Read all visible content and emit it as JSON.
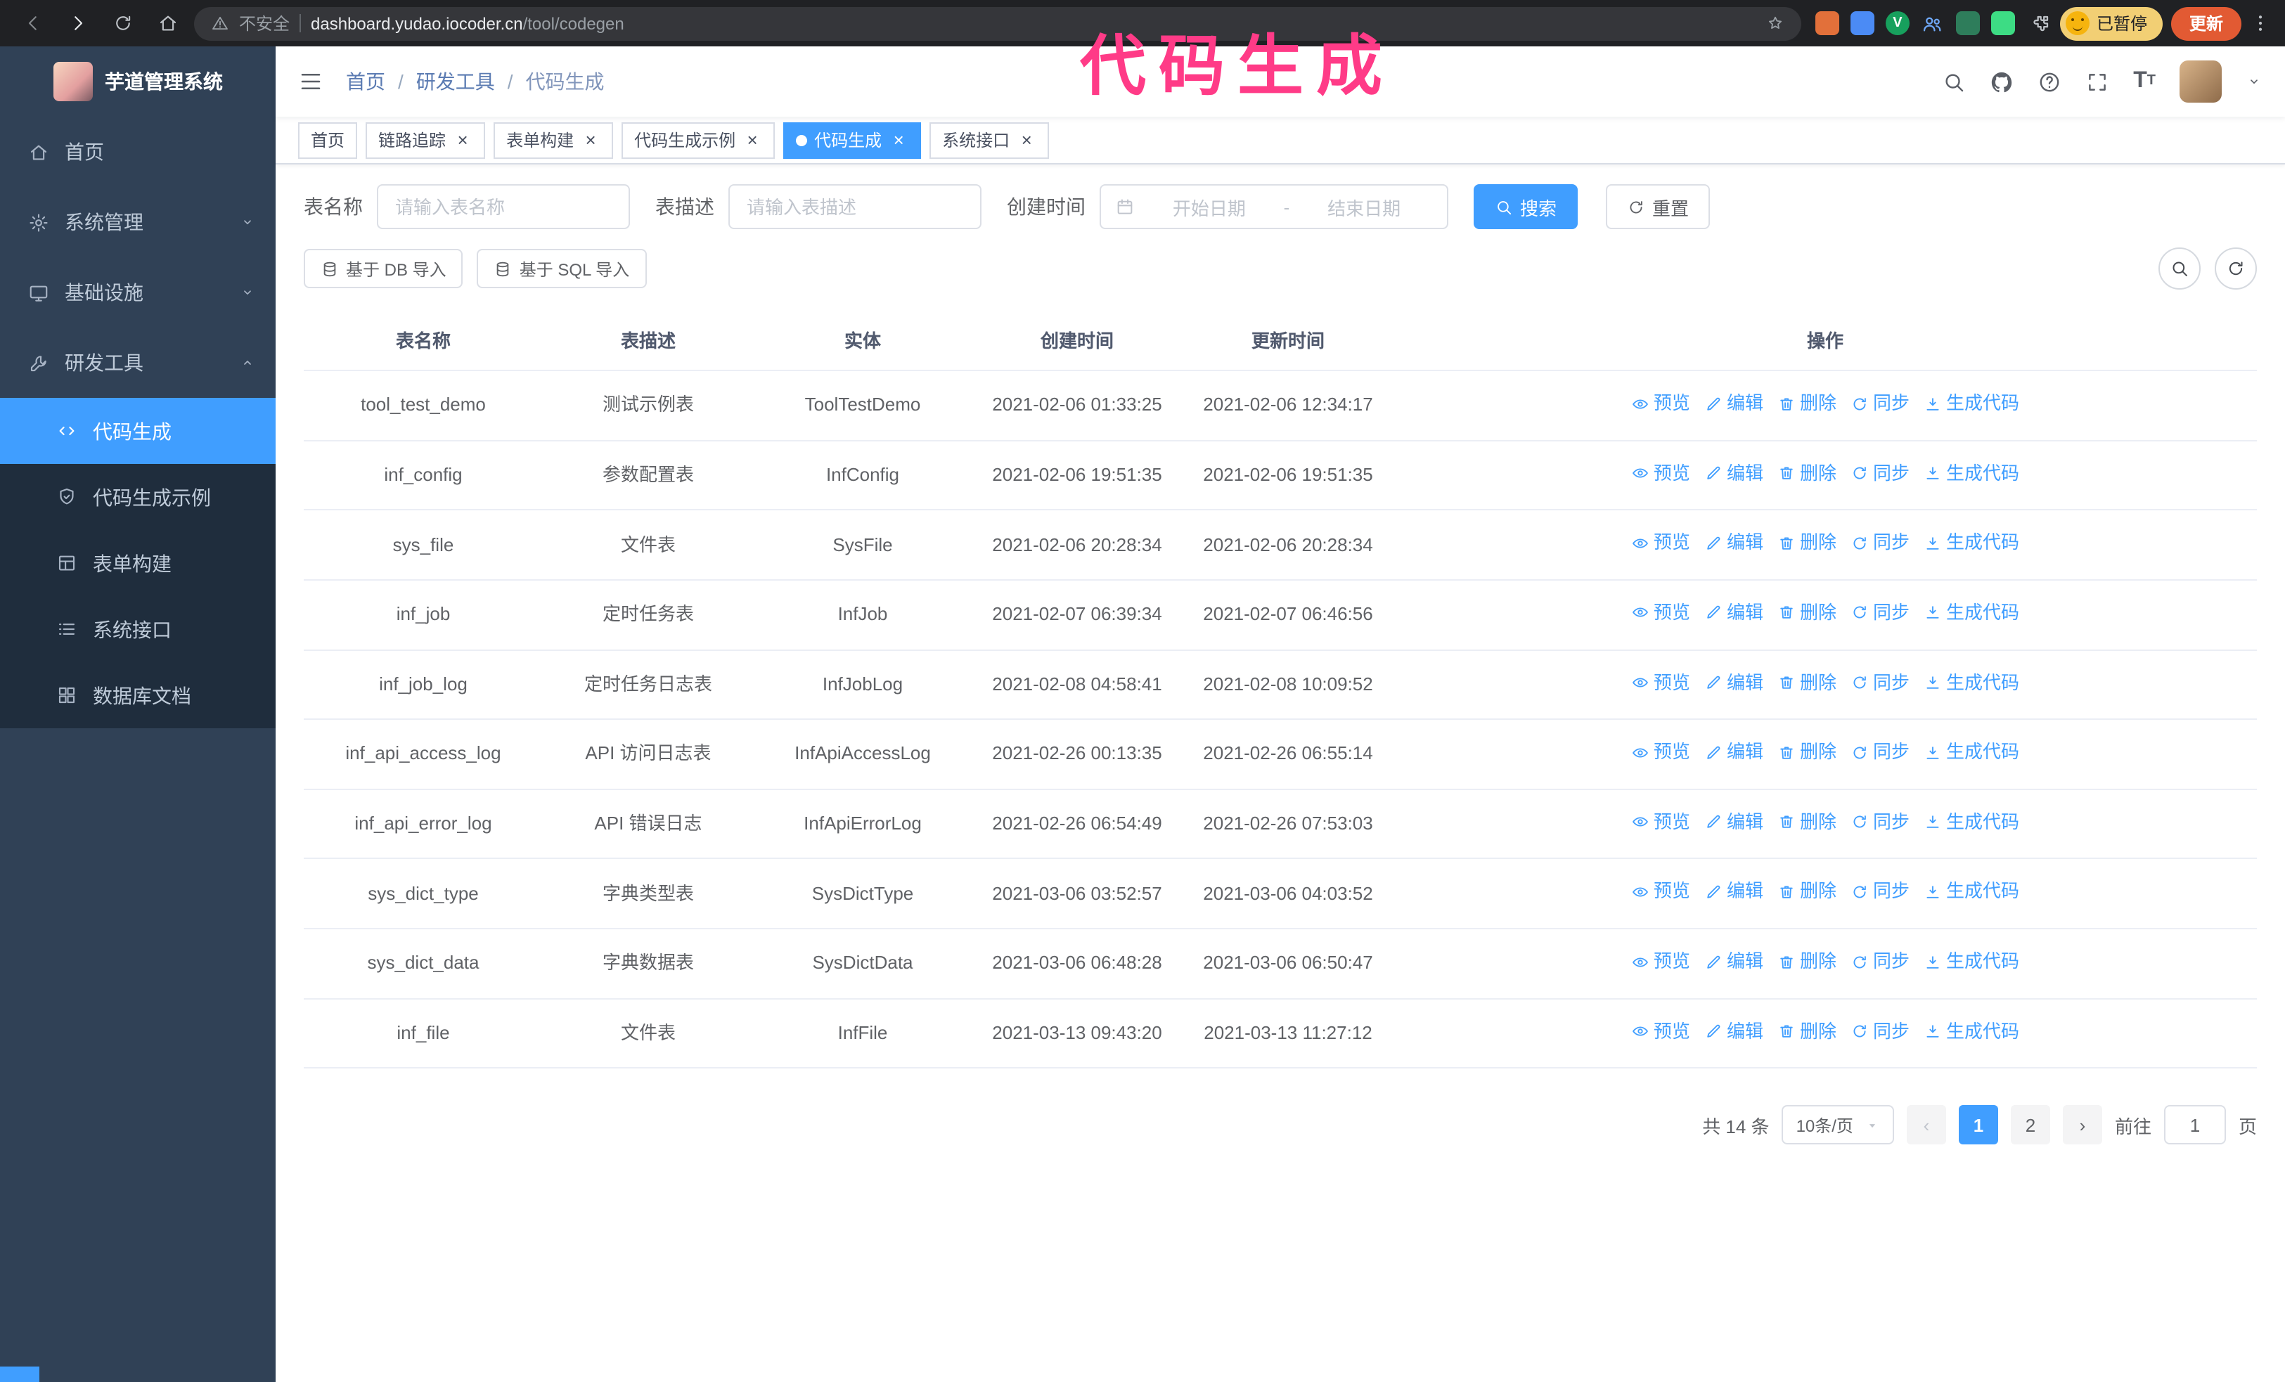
{
  "colors": {
    "primary": "#409eff",
    "sidebar_bg": "#304156",
    "submenu_bg": "#1f2d3d",
    "chrome_bg": "#202124",
    "annotation": "#ff3b87"
  },
  "annotation": {
    "text": "代码生成"
  },
  "browser": {
    "security_label": "不安全",
    "url_host": "dashboard.yudao.iocoder.cn",
    "url_path": "/tool/codegen",
    "profile_chip": "已暂停",
    "update_button": "更新",
    "extensions": [
      {
        "key": "extension-orange",
        "color": "#e2703a",
        "shape": "square",
        "glyph": ""
      },
      {
        "key": "extension-blue",
        "color": "#4b8bf5",
        "shape": "square",
        "glyph": ""
      },
      {
        "key": "extension-green-v",
        "color": "#17a05d",
        "shape": "circle",
        "glyph": "V"
      },
      {
        "key": "extension-people",
        "color": "#6fa8f8",
        "shape": "people",
        "glyph": ""
      },
      {
        "key": "extension-teal",
        "color": "#2e7d5b",
        "shape": "square",
        "glyph": ""
      },
      {
        "key": "extension-lime",
        "color": "#3ddc84",
        "shape": "square",
        "glyph": ""
      }
    ]
  },
  "sidebar": {
    "logo_title": "芋道管理系统",
    "items": [
      {
        "key": "home",
        "label": "首页",
        "icon": "home",
        "type": "item"
      },
      {
        "key": "system",
        "label": "系统管理",
        "icon": "gear",
        "type": "group",
        "expanded": false
      },
      {
        "key": "infra",
        "label": "基础设施",
        "icon": "monitor",
        "type": "group",
        "expanded": false
      },
      {
        "key": "devtools",
        "label": "研发工具",
        "icon": "tools",
        "type": "group",
        "expanded": true,
        "children": [
          {
            "key": "codegen",
            "label": "代码生成",
            "icon": "code",
            "active": true
          },
          {
            "key": "codegen-example",
            "label": "代码生成示例",
            "icon": "shield",
            "active": false
          },
          {
            "key": "form-build",
            "label": "表单构建",
            "icon": "form",
            "active": false
          },
          {
            "key": "system-api",
            "label": "系统接口",
            "icon": "api",
            "active": false
          },
          {
            "key": "db-doc",
            "label": "数据库文档",
            "icon": "grid",
            "active": false
          }
        ]
      }
    ]
  },
  "topbar": {
    "breadcrumb": [
      "首页",
      "研发工具",
      "代码生成"
    ]
  },
  "tabs": [
    {
      "key": "home",
      "label": "首页",
      "closable": false,
      "active": false
    },
    {
      "key": "tracer",
      "label": "链路追踪",
      "closable": true,
      "active": false
    },
    {
      "key": "form-build",
      "label": "表单构建",
      "closable": true,
      "active": false
    },
    {
      "key": "codegen-example",
      "label": "代码生成示例",
      "closable": true,
      "active": false
    },
    {
      "key": "codegen",
      "label": "代码生成",
      "closable": true,
      "active": true
    },
    {
      "key": "system-api",
      "label": "系统接口",
      "closable": true,
      "active": false
    }
  ],
  "filters": {
    "name_label": "表名称",
    "name_placeholder": "请输入表名称",
    "desc_label": "表描述",
    "desc_placeholder": "请输入表描述",
    "time_label": "创建时间",
    "start_placeholder": "开始日期",
    "range_separator": "-",
    "end_placeholder": "结束日期",
    "search_button": "搜索",
    "reset_button": "重置"
  },
  "toolbar": {
    "import_db": "基于 DB 导入",
    "import_sql": "基于 SQL 导入"
  },
  "table": {
    "columns": [
      "表名称",
      "表描述",
      "实体",
      "创建时间",
      "更新时间",
      "操作"
    ],
    "actions": [
      "预览",
      "编辑",
      "删除",
      "同步",
      "生成代码"
    ],
    "rows": [
      {
        "name": "tool_test_demo",
        "desc": "测试示例表",
        "entity": "ToolTestDemo",
        "created": "2021-02-06 01:33:25",
        "updated": "2021-02-06 12:34:17"
      },
      {
        "name": "inf_config",
        "desc": "参数配置表",
        "entity": "InfConfig",
        "created": "2021-02-06 19:51:35",
        "updated": "2021-02-06 19:51:35"
      },
      {
        "name": "sys_file",
        "desc": "文件表",
        "entity": "SysFile",
        "created": "2021-02-06 20:28:34",
        "updated": "2021-02-06 20:28:34"
      },
      {
        "name": "inf_job",
        "desc": "定时任务表",
        "entity": "InfJob",
        "created": "2021-02-07 06:39:34",
        "updated": "2021-02-07 06:46:56"
      },
      {
        "name": "inf_job_log",
        "desc": "定时任务日志表",
        "entity": "InfJobLog",
        "created": "2021-02-08 04:58:41",
        "updated": "2021-02-08 10:09:52"
      },
      {
        "name": "inf_api_access_log",
        "desc": "API 访问日志表",
        "entity": "InfApiAccessLog",
        "created": "2021-02-26 00:13:35",
        "updated": "2021-02-26 06:55:14"
      },
      {
        "name": "inf_api_error_log",
        "desc": "API 错误日志",
        "entity": "InfApiErrorLog",
        "created": "2021-02-26 06:54:49",
        "updated": "2021-02-26 07:53:03"
      },
      {
        "name": "sys_dict_type",
        "desc": "字典类型表",
        "entity": "SysDictType",
        "created": "2021-03-06 03:52:57",
        "updated": "2021-03-06 04:03:52"
      },
      {
        "name": "sys_dict_data",
        "desc": "字典数据表",
        "entity": "SysDictData",
        "created": "2021-03-06 06:48:28",
        "updated": "2021-03-06 06:50:47"
      },
      {
        "name": "inf_file",
        "desc": "文件表",
        "entity": "InfFile",
        "created": "2021-03-13 09:43:20",
        "updated": "2021-03-13 11:27:12"
      }
    ]
  },
  "pagination": {
    "total_text": "共 14 条",
    "page_size": "10条/页",
    "pages": [
      "1",
      "2"
    ],
    "active_page": "1",
    "goto_label": "前往",
    "goto_value": "1",
    "goto_suffix": "页"
  }
}
